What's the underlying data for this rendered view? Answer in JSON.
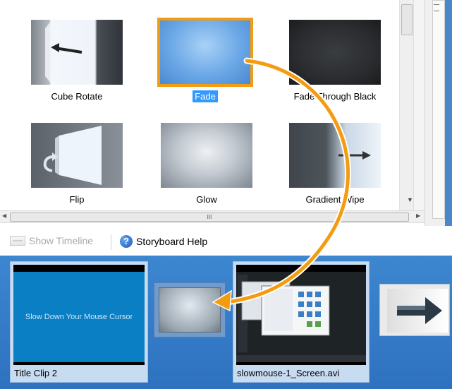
{
  "gallery": {
    "tiles": [
      {
        "label": "Cube Rotate",
        "icon": "cube-rotate-thumbnail"
      },
      {
        "label": "Fade",
        "icon": "fade-thumbnail",
        "selected": true
      },
      {
        "label": "Fade Through Black",
        "icon": "fade-through-black-thumbnail"
      },
      {
        "label": "Flip",
        "icon": "flip-thumbnail"
      },
      {
        "label": "Glow",
        "icon": "glow-thumbnail"
      },
      {
        "label": "Gradient Wipe",
        "icon": "gradient-wipe-thumbnail"
      }
    ],
    "hscroll_grip": "III"
  },
  "toolbar": {
    "show_timeline_label": "Show Timeline",
    "storyboard_help_label": "Storyboard Help",
    "help_glyph": "?"
  },
  "storyboard": {
    "clips": [
      {
        "label": "Title Clip 2",
        "title_text": "Slow Down Your Mouse Cursor"
      },
      {
        "label": "slowmouse-1_Screen.avi"
      }
    ]
  },
  "colors": {
    "selection_outline": "#f39c12",
    "arrow": "#f39c12",
    "storyboard_bg": "#3d86d0",
    "label_selection": "#3399ff"
  }
}
